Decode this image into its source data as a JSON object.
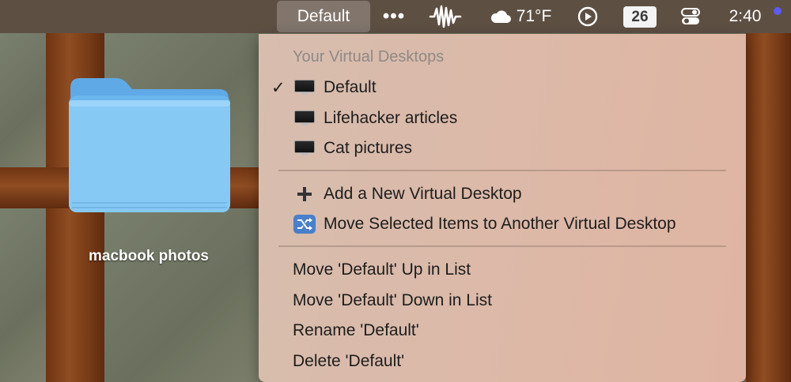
{
  "menubar": {
    "active_menu": "Default",
    "more_label": "•••",
    "weather_temp": "71°F",
    "date_badge": "26",
    "clock": "2:40"
  },
  "desktop": {
    "folder_label": "macbook photos"
  },
  "menu": {
    "header": "Your Virtual Desktops",
    "desktops": [
      {
        "label": "Default",
        "checked": true
      },
      {
        "label": "Lifehacker articles",
        "checked": false
      },
      {
        "label": "Cat pictures",
        "checked": false
      }
    ],
    "actions": [
      {
        "label": "Add a New Virtual Desktop",
        "icon": "plus-icon"
      },
      {
        "label": "Move Selected Items to Another Virtual Desktop",
        "icon": "shuffle-icon"
      }
    ],
    "list_actions": [
      {
        "label": "Move 'Default' Up in List"
      },
      {
        "label": "Move 'Default' Down in List"
      },
      {
        "label": "Rename 'Default'"
      },
      {
        "label": "Delete 'Default'"
      }
    ],
    "check_mark": "✓"
  },
  "colors": {
    "accent_dot": "#5b5cf0",
    "menu_bg": "#dcb9a8",
    "folder_blue": "#7ec3f2"
  }
}
